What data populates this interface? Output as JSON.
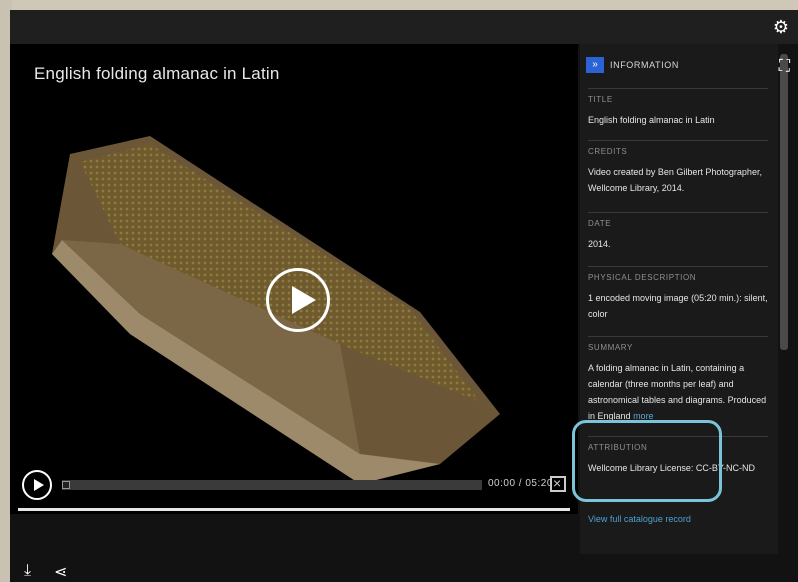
{
  "viewer": {
    "title": "English folding almanac in Latin",
    "time_display": "00:00 / 05:20",
    "progress_fraction": 0
  },
  "panel": {
    "heading": "INFORMATION",
    "sections": [
      {
        "label": "TITLE",
        "text": "English folding almanac in Latin"
      },
      {
        "label": "CREDITS",
        "text": "Video created by Ben Gilbert Photographer, Wellcome Library, 2014."
      },
      {
        "label": "DATE",
        "text": "2014."
      },
      {
        "label": "PHYSICAL DESCRIPTION",
        "text": "1 encoded moving image (05:20 min.): silent, color"
      },
      {
        "label": "SUMMARY",
        "text": "A folding almanac in Latin, containing a calendar (three months per leaf) and astronomical tables and diagrams. Produced in England",
        "more": "more"
      },
      {
        "label": "ATTRIBUTION",
        "text": "Wellcome Library License: CC-BY-NC-ND"
      }
    ],
    "catalogue_link": "View full catalogue record"
  },
  "icons": {
    "settings": "gear-icon",
    "download": "download-icon",
    "share": "share-icon",
    "fullscreen": "fullscreen-icon",
    "panel_toggle": "double-chevron-icon"
  },
  "colors": {
    "highlight_box": "#7ac3d9",
    "link": "#4fa0d0",
    "toggle_button": "#2b62d4"
  }
}
